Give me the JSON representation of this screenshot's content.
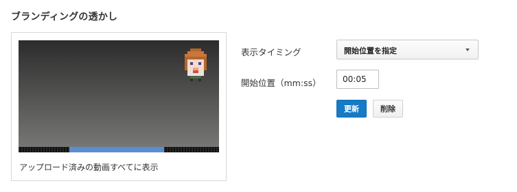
{
  "section": {
    "title": "ブランディングの透かし"
  },
  "preview": {
    "caption": "アップロード済みの動画すべてに表示",
    "watermark_icon": "pixel-character-icon",
    "progress_segment": {
      "start_fraction": 0.255,
      "end_fraction": 0.728
    },
    "colors": {
      "segment": "#5b8ed1",
      "track": "#1a1a1a"
    }
  },
  "settings": {
    "timing_label": "表示タイミング",
    "timing_selected": "開始位置を指定",
    "start_label": "開始位置（mm:ss）",
    "start_value": "00:05",
    "update_button": "更新",
    "delete_button": "削除",
    "colors": {
      "primary": "#167ac6"
    }
  }
}
